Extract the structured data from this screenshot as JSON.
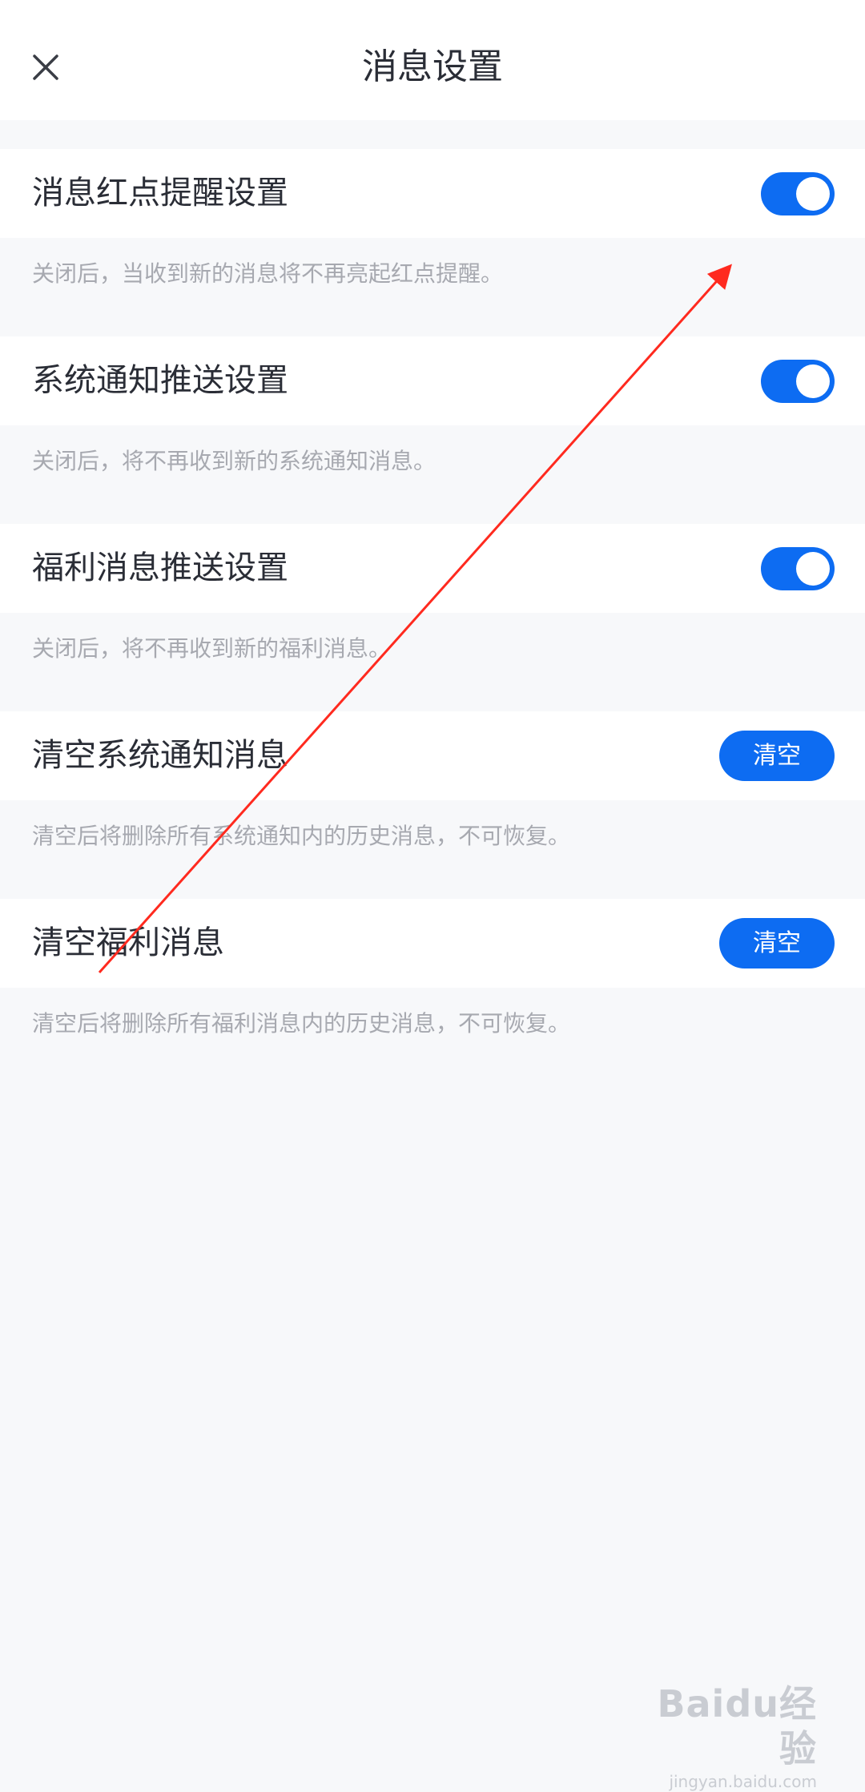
{
  "header": {
    "title": "消息设置"
  },
  "settings": [
    {
      "label": "消息红点提醒设置",
      "control": "toggle",
      "enabled": true,
      "description": "关闭后，当收到新的消息将不再亮起红点提醒。"
    },
    {
      "label": "系统通知推送设置",
      "control": "toggle",
      "enabled": true,
      "description": "关闭后，将不再收到新的系统通知消息。"
    },
    {
      "label": "福利消息推送设置",
      "control": "toggle",
      "enabled": true,
      "description": "关闭后，将不再收到新的福利消息。"
    },
    {
      "label": "清空系统通知消息",
      "control": "button",
      "button_label": "清空",
      "description": "清空后将删除所有系统通知内的历史消息，不可恢复。"
    },
    {
      "label": "清空福利消息",
      "control": "button",
      "button_label": "清空",
      "description": "清空后将删除所有福利消息内的历史消息，不可恢复。"
    }
  ],
  "watermark": {
    "logo": "Baidu经验",
    "url": "jingyan.baidu.com"
  },
  "colors": {
    "accent": "#0d6cf2",
    "annotation_arrow": "#ff2a1f"
  },
  "icons": {
    "close": "close-icon"
  }
}
